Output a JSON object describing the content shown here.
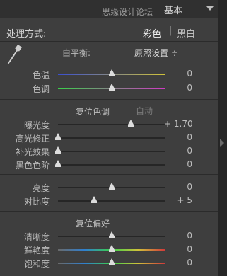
{
  "header": {
    "watermark": "思缘设计论坛",
    "panel_name": "基本"
  },
  "treatment": {
    "label": "处理方式:",
    "color_option": "彩色",
    "bw_option": "黑白"
  },
  "white_balance": {
    "label": "白平衡:",
    "value": "原照设置 ≑"
  },
  "sliders": {
    "temp": {
      "label": "色温",
      "value": "0",
      "level": 0.5
    },
    "tint": {
      "label": "色调",
      "value": "0",
      "level": 0.5
    },
    "exposure": {
      "label": "曝光度",
      "value": "+ 1.70",
      "level": 0.685
    },
    "recovery": {
      "label": "高光修正",
      "value": "0",
      "level": 0.0
    },
    "fill": {
      "label": "补光效果",
      "value": "0",
      "level": 0.0
    },
    "blacks": {
      "label": "黑色色阶",
      "value": "0",
      "level": 0.0
    },
    "brightness": {
      "label": "亮度",
      "value": "0",
      "level": 0.5
    },
    "contrast": {
      "label": "对比度",
      "value": "+ 5",
      "level": 0.34
    },
    "clarity": {
      "label": "清晰度",
      "value": "0",
      "level": 0.5
    },
    "vibrance": {
      "label": "鲜艳度",
      "value": "0",
      "level": 0.5
    },
    "saturation": {
      "label": "饱和度",
      "value": "0",
      "level": 0.5
    }
  },
  "tone": {
    "reset_label": "复位色调",
    "auto_label": "自动"
  },
  "presence": {
    "reset_label": "复位偏好"
  },
  "colors": {
    "panel_bg": "#3e3e3e",
    "temp_gradient": [
      "#3a4fd0",
      "#d0c23a"
    ],
    "tint_gradient": [
      "#3ad04a",
      "#d03ac4"
    ]
  }
}
